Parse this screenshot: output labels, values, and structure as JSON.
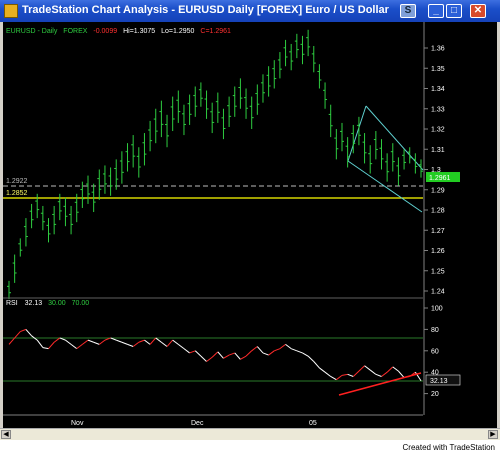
{
  "window": {
    "title": "TradeStation Chart Analysis - EURUSD  Daily  [FOREX] Euro / US Dollar",
    "buttons": {
      "special": "S",
      "minimize": "_",
      "maximize": "□",
      "close": "✕"
    }
  },
  "price_header": {
    "symbol": "EURUSD - Daily",
    "exchange": "FOREX",
    "change": "-0.0099",
    "high": "Hi=1.3075",
    "low": "Lo=1.2950",
    "close": "C=1.2961"
  },
  "rsi_header": {
    "name": "RSI",
    "value": "32.13",
    "lower": "30.00",
    "upper": "70.00"
  },
  "axes": {
    "price_ticks": [
      "1.36",
      "1.35",
      "1.34",
      "1.33",
      "1.32",
      "1.31",
      "1.3",
      "1.29",
      "1.28",
      "1.27",
      "1.26",
      "1.25",
      "1.24"
    ],
    "rsi_ticks": [
      "100",
      "80",
      "60",
      "40",
      "20"
    ],
    "month_labels": [
      "Nov",
      "Dec",
      "05"
    ]
  },
  "lines": {
    "support_level": "1.2922",
    "yellow_level": "1.2852",
    "last_price": "1.2961",
    "rsi_last": "32.13"
  },
  "colors": {
    "background": "#000000",
    "bars": "#2ecc40",
    "rsi_up": "#ff2a2a",
    "rsi_down": "#ffffff",
    "yellow_line": "#ffff00",
    "channel": "#5fd0d0",
    "rsi_trend": "#ff2020",
    "last_price_box": "#22cc22"
  },
  "credit": "Created with TradeStation",
  "chart_data": {
    "type": "ohlc",
    "series": [
      {
        "name": "EURUSD - Daily",
        "values": [
          [
            1.236,
            1.245
          ],
          [
            1.244,
            1.258
          ],
          [
            1.257,
            1.266
          ],
          [
            1.262,
            1.276
          ],
          [
            1.271,
            1.283
          ],
          [
            1.276,
            1.288
          ],
          [
            1.27,
            1.282
          ],
          [
            1.264,
            1.276
          ],
          [
            1.268,
            1.282
          ],
          [
            1.275,
            1.288
          ],
          [
            1.272,
            1.286
          ],
          [
            1.268,
            1.282
          ],
          [
            1.274,
            1.288
          ],
          [
            1.281,
            1.294
          ],
          [
            1.283,
            1.297
          ],
          [
            1.279,
            1.293
          ],
          [
            1.285,
            1.3
          ],
          [
            1.288,
            1.302
          ],
          [
            1.287,
            1.301
          ],
          [
            1.29,
            1.305
          ],
          [
            1.293,
            1.309
          ],
          [
            1.299,
            1.313
          ],
          [
            1.301,
            1.317
          ],
          [
            1.296,
            1.311
          ],
          [
            1.302,
            1.318
          ],
          [
            1.309,
            1.324
          ],
          [
            1.313,
            1.33
          ],
          [
            1.316,
            1.334
          ],
          [
            1.311,
            1.327
          ],
          [
            1.319,
            1.336
          ],
          [
            1.323,
            1.339
          ],
          [
            1.317,
            1.332
          ],
          [
            1.322,
            1.337
          ],
          [
            1.326,
            1.341
          ],
          [
            1.331,
            1.343
          ],
          [
            1.325,
            1.339
          ],
          [
            1.318,
            1.333
          ],
          [
            1.323,
            1.338
          ],
          [
            1.315,
            1.33
          ],
          [
            1.321,
            1.336
          ],
          [
            1.326,
            1.341
          ],
          [
            1.33,
            1.345
          ],
          [
            1.325,
            1.34
          ],
          [
            1.32,
            1.336
          ],
          [
            1.327,
            1.342
          ],
          [
            1.333,
            1.347
          ],
          [
            1.336,
            1.351
          ],
          [
            1.34,
            1.354
          ],
          [
            1.345,
            1.358
          ],
          [
            1.351,
            1.364
          ],
          [
            1.349,
            1.362
          ],
          [
            1.355,
            1.367
          ],
          [
            1.352,
            1.366
          ],
          [
            1.356,
            1.369
          ],
          [
            1.348,
            1.361
          ],
          [
            1.34,
            1.352
          ],
          [
            1.33,
            1.343
          ],
          [
            1.316,
            1.332
          ],
          [
            1.305,
            1.32
          ],
          [
            1.309,
            1.323
          ],
          [
            1.301,
            1.316
          ],
          [
            1.308,
            1.322
          ],
          [
            1.312,
            1.326
          ],
          [
            1.303,
            1.318
          ],
          [
            1.298,
            1.312
          ],
          [
            1.305,
            1.319
          ],
          [
            1.3,
            1.315
          ],
          [
            1.294,
            1.308
          ],
          [
            1.299,
            1.313
          ],
          [
            1.292,
            1.306
          ],
          [
            1.3,
            1.31
          ],
          [
            1.303,
            1.311
          ],
          [
            1.298,
            1.308
          ],
          [
            1.296,
            1.305
          ]
        ]
      },
      {
        "name": "RSI",
        "values": [
          66,
          72,
          78,
          80,
          74,
          70,
          63,
          62,
          68,
          72,
          70,
          66,
          62,
          66,
          70,
          68,
          66,
          70,
          72,
          70,
          68,
          66,
          64,
          68,
          70,
          66,
          72,
          68,
          64,
          70,
          66,
          62,
          58,
          60,
          55,
          50,
          54,
          59,
          53,
          56,
          58,
          52,
          55,
          60,
          64,
          58,
          56,
          60,
          62,
          66,
          62,
          60,
          58,
          55,
          50,
          44,
          40,
          36,
          33,
          37,
          38,
          36,
          41,
          46,
          42,
          38,
          36,
          40,
          45,
          41,
          35,
          36,
          40,
          32
        ]
      }
    ],
    "ylim_price": [
      1.235,
      1.37
    ],
    "ylim_rsi": [
      10,
      100
    ],
    "rsi_levels": [
      30,
      70
    ],
    "horizontal_levels": [
      1.2922,
      1.2852
    ],
    "x_labels": [
      "Nov",
      "Dec",
      "05"
    ],
    "grid": false,
    "legend": "top-left"
  }
}
